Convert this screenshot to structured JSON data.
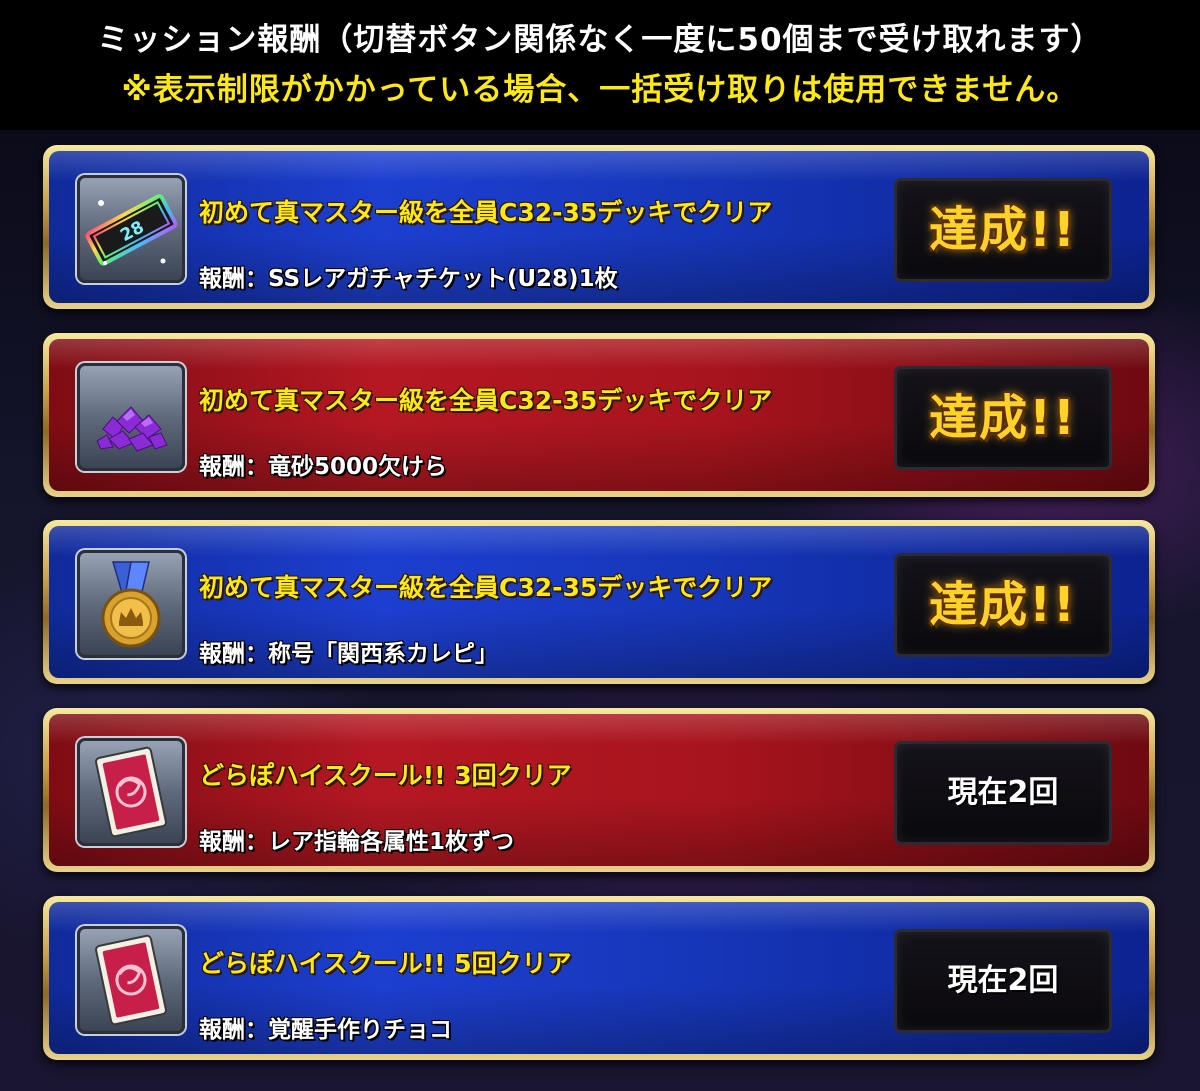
{
  "header": {
    "line1": "ミッション報酬（切替ボタン関係なく一度に50個まで受け取れます）",
    "line2": "※表示制限がかかっている場合、一括受け取りは使用できません。"
  },
  "missions": [
    {
      "title": "初めて真マスター級を全員C32-35デッキでクリア",
      "reward": "報酬：SSレアガチャチケット(U28)1枚",
      "status": "達成!!",
      "icon": "gacha-ticket-icon"
    },
    {
      "title": "初めて真マスター級を全員C32-35デッキでクリア",
      "reward": "報酬：竜砂5000欠けら",
      "status": "達成!!",
      "icon": "dragon-sand-icon"
    },
    {
      "title": "初めて真マスター級を全員C32-35デッキでクリア",
      "reward": "報酬：称号「関西系カレピ」",
      "status": "達成!!",
      "icon": "medal-icon"
    },
    {
      "title": "どらぽハイスクール!! 3回クリア",
      "reward": "報酬：レア指輪各属性1枚ずつ",
      "status": "現在2回",
      "icon": "card-icon"
    },
    {
      "title": "どらぽハイスクール!! 5回クリア",
      "reward": "報酬：覚醒手作りチョコ",
      "status": "現在2回",
      "icon": "card-icon"
    }
  ],
  "colors": {
    "title_yellow": "#ffe818",
    "blue_card": "#1d3fd0",
    "red_card": "#b51822",
    "gold_frame": "#c9a24a"
  }
}
